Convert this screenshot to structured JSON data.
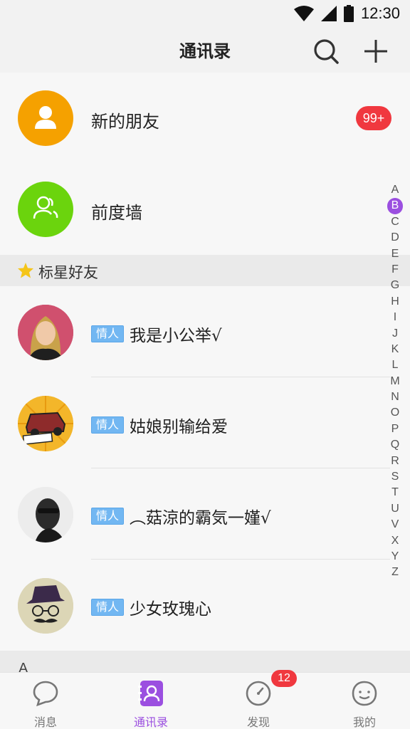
{
  "status_bar": {
    "time": "12:30",
    "icons": [
      "wifi-icon",
      "signal-icon",
      "battery-icon"
    ]
  },
  "header": {
    "title": "通讯录",
    "actions": [
      "search-icon",
      "plus-icon"
    ]
  },
  "top_items": [
    {
      "label": "新的朋友",
      "icon": "user-icon",
      "color": "#f5a100",
      "badge": "99+"
    },
    {
      "label": "前度墙",
      "icon": "users-icon",
      "color": "#6bd40d"
    }
  ],
  "starred_section": {
    "title": "标星好友",
    "icon": "star-icon"
  },
  "friends": [
    {
      "tag": "情人",
      "name": "我是小公举√"
    },
    {
      "tag": "情人",
      "name": "姑娘别输给爱"
    },
    {
      "tag": "情人",
      "name": "︵菇涼的霸気一�republished√"
    },
    {
      "tag": "情人",
      "name": "少女玫瑰心"
    }
  ],
  "next_section": "A",
  "index_letters": [
    "A",
    "B",
    "C",
    "D",
    "E",
    "F",
    "G",
    "H",
    "I",
    "J",
    "K",
    "L",
    "M",
    "N",
    "O",
    "P",
    "Q",
    "R",
    "S",
    "T",
    "U",
    "V",
    "X",
    "Y",
    "Z"
  ],
  "index_active": "B",
  "bottom_nav": [
    {
      "label": "消息",
      "icon": "chat-bubble-icon",
      "active": false
    },
    {
      "label": "通讯录",
      "icon": "contacts-icon",
      "active": true
    },
    {
      "label": "发现",
      "icon": "compass-icon",
      "active": false,
      "badge": "12"
    },
    {
      "label": "我的",
      "icon": "smiley-icon",
      "active": false
    }
  ],
  "colors": {
    "accent": "#9b4fe0",
    "badge_red": "#f0383f",
    "tag_blue": "#72b7f2"
  }
}
